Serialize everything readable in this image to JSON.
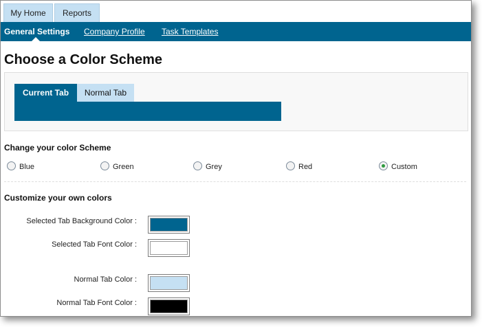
{
  "top_tabs": [
    {
      "label": "My Home"
    },
    {
      "label": "Reports"
    }
  ],
  "subnav": {
    "active": "General Settings",
    "links": [
      "Company Profile",
      "Task Templates"
    ]
  },
  "page_title": "Choose a Color Scheme",
  "preview": {
    "current_tab": "Current Tab",
    "normal_tab": "Normal Tab"
  },
  "scheme_section": {
    "heading": "Change your color Scheme",
    "options": [
      {
        "label": "Blue",
        "checked": false
      },
      {
        "label": "Green",
        "checked": false
      },
      {
        "label": "Grey",
        "checked": false
      },
      {
        "label": "Red",
        "checked": false
      },
      {
        "label": "Custom",
        "checked": true
      }
    ]
  },
  "custom_section": {
    "heading": "Customize your own colors",
    "rows": [
      {
        "label": "Selected Tab Background Color :",
        "color": "#00648f"
      },
      {
        "label": "Selected Tab Font Color :",
        "color": "#ffffff"
      },
      {
        "label": "Normal Tab Color :",
        "color": "#c5e0f3"
      },
      {
        "label": "Normal Tab Font Color :",
        "color": "#000000"
      }
    ]
  },
  "colors": {
    "primary": "#00648f",
    "normal_tab": "#c5e0f3",
    "radio_checked": "#2e9a3e"
  }
}
